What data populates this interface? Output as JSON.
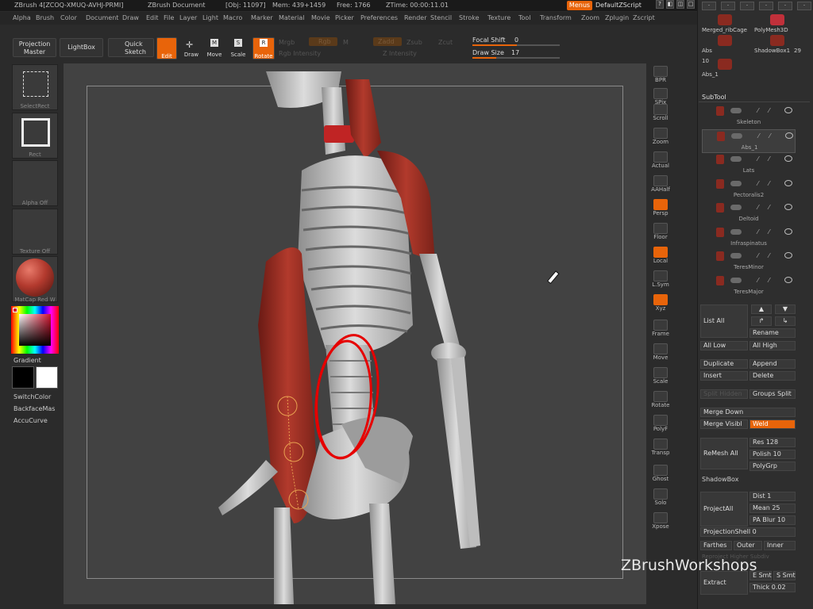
{
  "title": {
    "app": "ZBrush 4[ZCOQ-XMUQ-AVHJ-PRMI]",
    "document": "ZBrush Document",
    "obj": "[Obj: 11097]",
    "mem": "Mem: 439+1459",
    "free": "Free: 1766",
    "ztime": "ZTime: 00:00:11.01",
    "menus_btn": "Menus",
    "default_zscript": "DefaultZScript"
  },
  "menu": [
    "Alpha",
    "Brush",
    "Color",
    "Document",
    "Draw",
    "Edit",
    "File",
    "Layer",
    "Light",
    "Macro",
    "Marker",
    "Material",
    "Movie",
    "Picker",
    "Preferences",
    "Render",
    "Stencil",
    "Stroke",
    "Texture",
    "Tool",
    "Transform",
    "Zoom",
    "Zplugin",
    "Zscript"
  ],
  "toolbar": {
    "projection_master": "Projection Master",
    "lightbox": "LightBox",
    "quick_sketch": "Quick Sketch",
    "edit": "Edit",
    "draw": "Draw",
    "move": "Move",
    "scale": "Scale",
    "rotate": "Rotate",
    "mrgb": "Mrgb",
    "rgb": "Rgb",
    "m": "M",
    "zadd": "Zadd",
    "zsub": "Zsub",
    "zcut": "Zcut",
    "rgb_intensity": "Rgb Intensity",
    "z_intensity": "Z Intensity",
    "focal_shift_label": "Focal Shift",
    "focal_shift_value": "0",
    "draw_size_label": "Draw Size",
    "draw_size_value": "17"
  },
  "left_shelf": {
    "select_rect": "SelectRect",
    "rect": "Rect",
    "alpha_off": "Alpha Off",
    "texture_off": "Texture Off",
    "material": "MatCap Red W",
    "gradient": "Gradient",
    "switch_color": "SwitchColor",
    "backface_mask": "BackfaceMas",
    "accu_curve": "AccuCurve",
    "colors": {
      "brush_red": "#b33a2e",
      "gradient_main": "#000000",
      "gradient_secondary": "#ffffff"
    }
  },
  "right_shelf": [
    "BPR",
    "SPix",
    "Scroll",
    "Zoom",
    "Actual",
    "AAHalf",
    "Persp",
    "Floor",
    "Local",
    "L.Sym",
    "Xyz",
    "Frame",
    "Move",
    "Scale",
    "Rotate",
    "PolyF",
    "Transp",
    "Ghost",
    "Solo",
    "Xpose"
  ],
  "right_shelf_active": [
    "Persp",
    "Local",
    "Xyz"
  ],
  "tool_panel": {
    "recent_tools": [
      {
        "name": "Merged_ribCage",
        "icon": "mesh-icon"
      },
      {
        "name": "PolyMesh3D",
        "icon": "star-icon"
      },
      {
        "name": "Abs",
        "icon": "mesh-icon"
      },
      {
        "name": "ShadowBox1",
        "count": "29",
        "icon": "mesh-icon"
      },
      {
        "name": "Abs_1",
        "count": "10",
        "icon": "mesh-icon"
      }
    ],
    "subtool_title": "SubTool",
    "subtools": [
      "Skeleton",
      "Abs_1",
      "Lats",
      "Pectoralis2",
      "Deltoid",
      "Infraspinatus",
      "TeresMinor",
      "TeresMajor"
    ],
    "selected_subtool": "Abs_1",
    "buttons": {
      "list_all": "List All",
      "rename": "Rename",
      "all_low": "All Low",
      "all_high": "All High",
      "duplicate": "Duplicate",
      "append": "Append",
      "insert": "Insert",
      "delete": "Delete",
      "split_hidden": "Split Hidden",
      "groups_split": "Groups Split",
      "merge_down": "Merge Down",
      "merge_visible": "Merge Visibl",
      "weld": "Weld",
      "remesh_all": "ReMesh All",
      "res": "Res 128",
      "polish": "Polish 10",
      "polygrp": "PolyGrp",
      "shadowbox": "ShadowBox",
      "project_all": "ProjectAll",
      "dist": "Dist 1",
      "mean": "Mean 25",
      "pa_blur": "PA Blur 10",
      "projection_shell": "ProjectionShell 0",
      "farthest": "Farthes",
      "outer": "Outer",
      "inner": "Inner",
      "reproject": "Reproject Higher Subdiv",
      "extract": "Extract",
      "e_smt": "E Smt",
      "s_smt": "S Smt",
      "thick": "Thick 0.02"
    }
  },
  "watermark": "ZBrushWorkshops",
  "accent_color": "#e8640a"
}
